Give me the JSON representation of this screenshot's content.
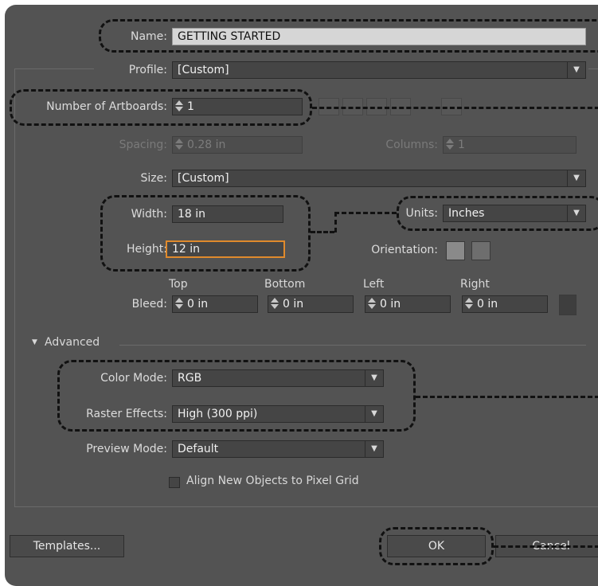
{
  "name": {
    "label": "Name:",
    "value": "GETTING STARTED"
  },
  "profile": {
    "label": "Profile:",
    "value": "[Custom]"
  },
  "artboards": {
    "label": "Number of Artboards:",
    "value": "1"
  },
  "spacing": {
    "label": "Spacing:",
    "value": "0.28 in"
  },
  "columns": {
    "label": "Columns:",
    "value": "1"
  },
  "size": {
    "label": "Size:",
    "value": "[Custom]"
  },
  "width": {
    "label": "Width:",
    "value": "18 in"
  },
  "height": {
    "label": "Height:",
    "value": "12 in"
  },
  "units": {
    "label": "Units:",
    "value": "Inches"
  },
  "orientation": {
    "label": "Orientation:"
  },
  "bleed": {
    "label": "Bleed:",
    "top": {
      "label": "Top",
      "value": "0 in"
    },
    "bottom": {
      "label": "Bottom",
      "value": "0 in"
    },
    "left": {
      "label": "Left",
      "value": "0 in"
    },
    "right": {
      "label": "Right",
      "value": "0 in"
    }
  },
  "advanced": {
    "label": "Advanced"
  },
  "color_mode": {
    "label": "Color Mode:",
    "value": "RGB"
  },
  "raster_effects": {
    "label": "Raster Effects:",
    "value": "High (300 ppi)"
  },
  "preview_mode": {
    "label": "Preview Mode:",
    "value": "Default"
  },
  "align_pixel_grid": {
    "label": "Align New Objects to Pixel Grid",
    "checked": false
  },
  "buttons": {
    "templates": "Templates...",
    "ok": "OK",
    "cancel": "Cancel"
  }
}
